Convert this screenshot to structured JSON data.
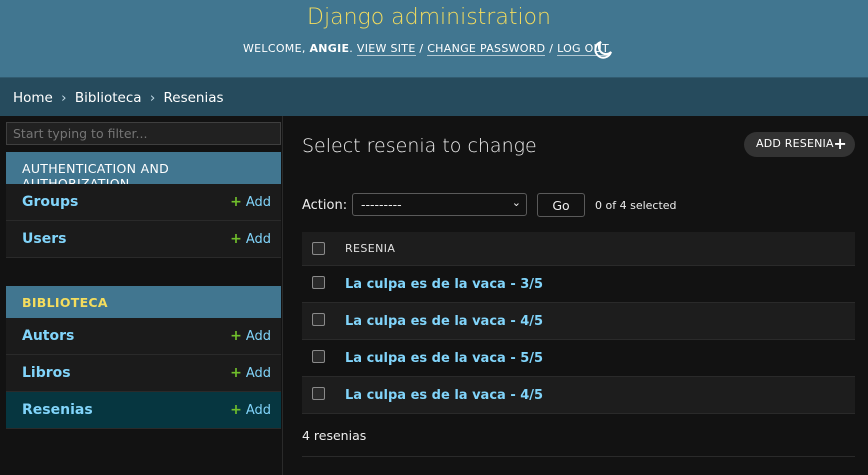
{
  "header": {
    "site_name": "Django administration",
    "welcome": "WELCOME, ",
    "username": "ANGIE",
    "after_user": ". ",
    "view_site": "VIEW SITE",
    "sep1": " / ",
    "change_password": "CHANGE PASSWORD",
    "sep2": " / ",
    "log_out": "LOG OUT",
    "theme_icon": "moon-icon"
  },
  "breadcrumbs": {
    "home": "Home",
    "app": "Biblioteca",
    "current": "Resenias",
    "separator": "›"
  },
  "sidebar": {
    "filter_placeholder": "Start typing to filter...",
    "modules": [
      {
        "caption": "AUTHENTICATION AND AUTHORIZATION",
        "models": [
          {
            "name": "Groups",
            "add": "Add"
          },
          {
            "name": "Users",
            "add": "Add"
          }
        ]
      },
      {
        "caption": "BIBLIOTECA",
        "models": [
          {
            "name": "Autors",
            "add": "Add"
          },
          {
            "name": "Libros",
            "add": "Add"
          },
          {
            "name": "Resenias",
            "add": "Add"
          }
        ]
      }
    ]
  },
  "content": {
    "title": "Select resenia to change",
    "add_button": "ADD RESENIA",
    "add_icon": "plus-icon",
    "action_label": "Action:",
    "action_selected": "---------",
    "go": "Go",
    "selection_count": "0 of 4 selected",
    "column_header": "RESENIA",
    "rows": [
      "La culpa es de la vaca - 3/5",
      "La culpa es de la vaca - 4/5",
      "La culpa es de la vaca - 5/5",
      "La culpa es de la vaca - 4/5"
    ],
    "paginator": "4 resenias"
  },
  "colors": {
    "header_bg": "#417690",
    "site_name": "#f5dd5d",
    "breadcrumbs_bg": "#264b5d",
    "link": "#81d4fa",
    "add_plus": "#70bf2b",
    "current_model_bg": "#063640",
    "page_bg": "#121212"
  }
}
